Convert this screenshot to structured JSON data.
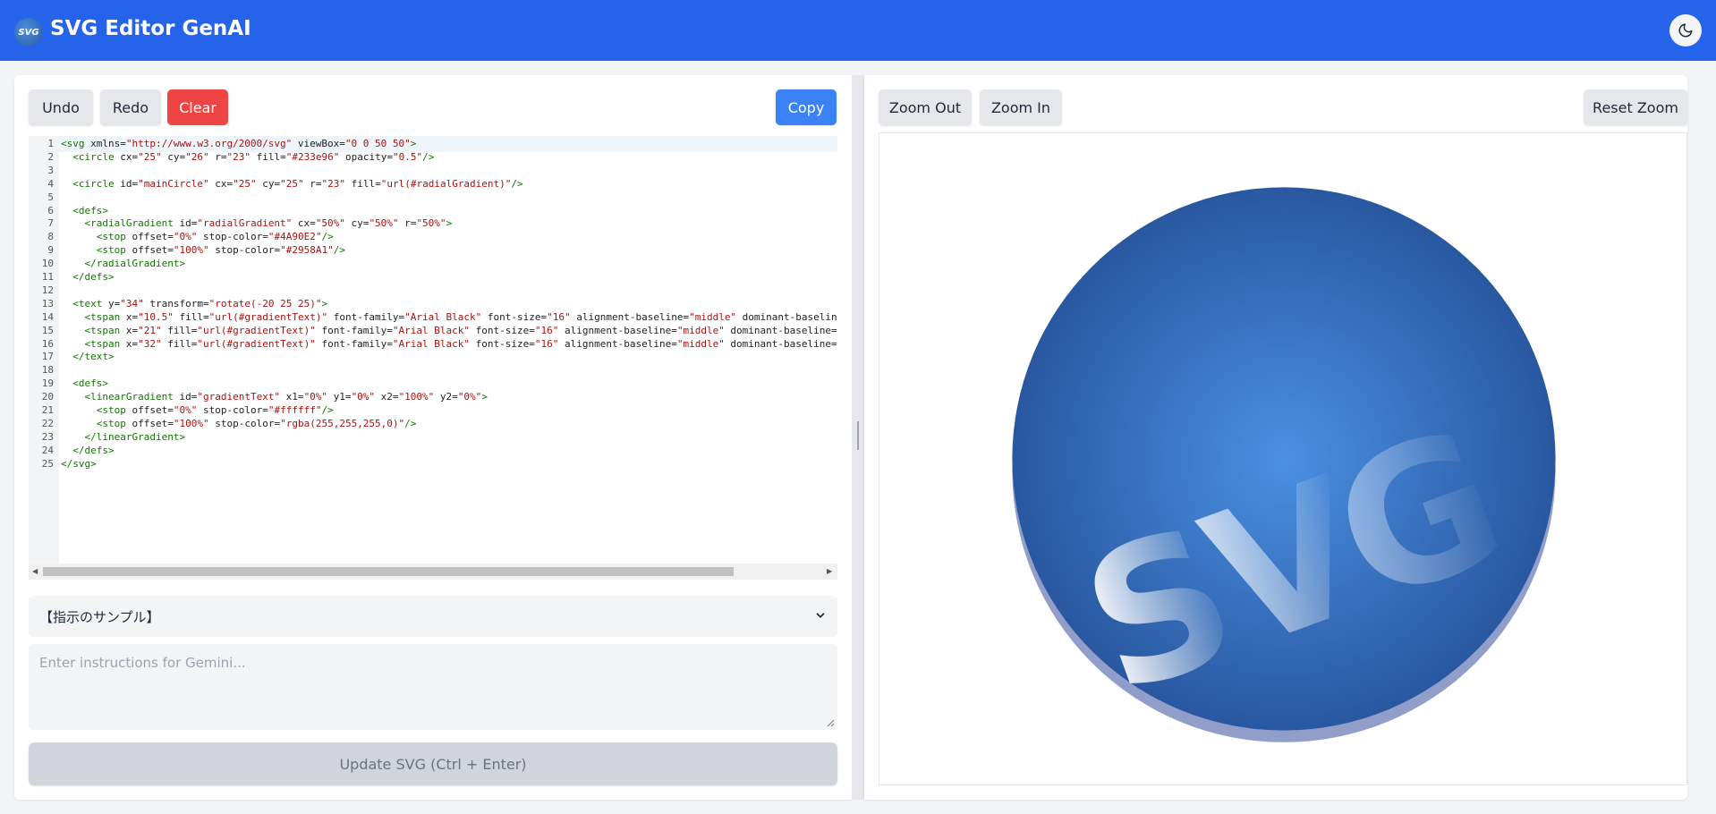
{
  "header": {
    "title": "SVG Editor GenAI",
    "logo_text": "SVG",
    "theme_icon": "moon-icon",
    "bg_color": "#2563eb"
  },
  "toolbar": {
    "undo_label": "Undo",
    "redo_label": "Redo",
    "clear_label": "Clear",
    "copy_label": "Copy"
  },
  "editor": {
    "line_numbers": [
      "1",
      "2",
      "3",
      "4",
      "5",
      "6",
      "7",
      "8",
      "9",
      "10",
      "11",
      "12",
      "13",
      "14",
      "15",
      "16",
      "17",
      "18",
      "19",
      "20",
      "21",
      "22",
      "23",
      "24",
      "25"
    ],
    "lines": [
      "<svg xmlns=\"http://www.w3.org/2000/svg\" viewBox=\"0 0 50 50\">",
      "  <circle cx=\"25\" cy=\"26\" r=\"23\" fill=\"#233e96\" opacity=\"0.5\"/>",
      "",
      "  <circle id=\"mainCircle\" cx=\"25\" cy=\"25\" r=\"23\" fill=\"url(#radialGradient)\"/>",
      "",
      "  <defs>",
      "    <radialGradient id=\"radialGradient\" cx=\"50%\" cy=\"50%\" r=\"50%\">",
      "      <stop offset=\"0%\" stop-color=\"#4A90E2\"/>",
      "      <stop offset=\"100%\" stop-color=\"#2958A1\"/>",
      "    </radialGradient>",
      "  </defs>",
      "",
      "  <text y=\"34\" transform=\"rotate(-20 25 25)\">",
      "    <tspan x=\"10.5\" fill=\"url(#gradientText)\" font-family=\"Arial Black\" font-size=\"16\" alignment-baseline=\"middle\" dominant-baseline=\"",
      "    <tspan x=\"21\" fill=\"url(#gradientText)\" font-family=\"Arial Black\" font-size=\"16\" alignment-baseline=\"middle\" dominant-baseline=\"m",
      "    <tspan x=\"32\" fill=\"url(#gradientText)\" font-family=\"Arial Black\" font-size=\"16\" alignment-baseline=\"middle\" dominant-baseline=\"m",
      "  </text>",
      "",
      "  <defs>",
      "    <linearGradient id=\"gradientText\" x1=\"0%\" y1=\"0%\" x2=\"100%\" y2=\"0%\">",
      "      <stop offset=\"0%\" stop-color=\"#ffffff\"/>",
      "      <stop offset=\"100%\" stop-color=\"rgba(255,255,255,0)\"/>",
      "    </linearGradient>",
      "  </defs>",
      "</svg>"
    ]
  },
  "instructions": {
    "sample_select_value": "【指示のサンプル】",
    "placeholder": "Enter instructions for Gemini...",
    "update_label": "Update SVG (Ctrl + Enter)"
  },
  "preview": {
    "zoom_out_label": "Zoom Out",
    "zoom_in_label": "Zoom In",
    "reset_zoom_label": "Reset Zoom",
    "letters": [
      "S",
      "V",
      "G"
    ],
    "colors": {
      "shadow": "#233e96",
      "gradient_start": "#4A90E2",
      "gradient_end": "#2958A1"
    }
  }
}
